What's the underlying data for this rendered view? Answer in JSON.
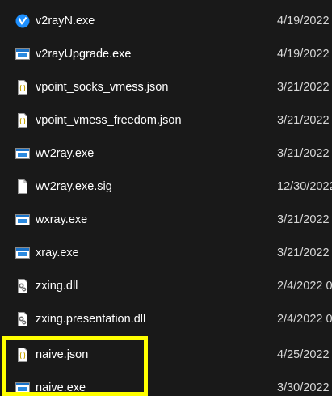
{
  "files": [
    {
      "name": "v2rayN.exe",
      "date": "4/19/2022",
      "icon": "v2rayn-app-icon"
    },
    {
      "name": "v2rayUpgrade.exe",
      "date": "4/19/2022",
      "icon": "exe-window-icon"
    },
    {
      "name": "vpoint_socks_vmess.json",
      "date": "3/21/2022",
      "icon": "json-file-icon"
    },
    {
      "name": "vpoint_vmess_freedom.json",
      "date": "3/21/2022",
      "icon": "json-file-icon"
    },
    {
      "name": "wv2ray.exe",
      "date": "3/21/2022",
      "icon": "exe-window-icon"
    },
    {
      "name": "wv2ray.exe.sig",
      "date": "12/30/2022",
      "icon": "blank-file-icon"
    },
    {
      "name": "wxray.exe",
      "date": "3/21/2022",
      "icon": "exe-window-icon"
    },
    {
      "name": "xray.exe",
      "date": "3/21/2022",
      "icon": "exe-window-icon"
    },
    {
      "name": "zxing.dll",
      "date": "2/4/2022 0",
      "icon": "dll-gear-file-icon"
    },
    {
      "name": "zxing.presentation.dll",
      "date": "2/4/2022 0",
      "icon": "dll-gear-file-icon"
    },
    {
      "name": "naive.json",
      "date": "4/25/2022",
      "icon": "json-file-icon"
    },
    {
      "name": "naive.exe",
      "date": "3/30/2022",
      "icon": "exe-window-icon"
    }
  ],
  "colors": {
    "background": "#191919",
    "highlight": "#ffff00",
    "v2rayn_blue": "#1e90ff",
    "exe_blue": "#1a73c9"
  }
}
